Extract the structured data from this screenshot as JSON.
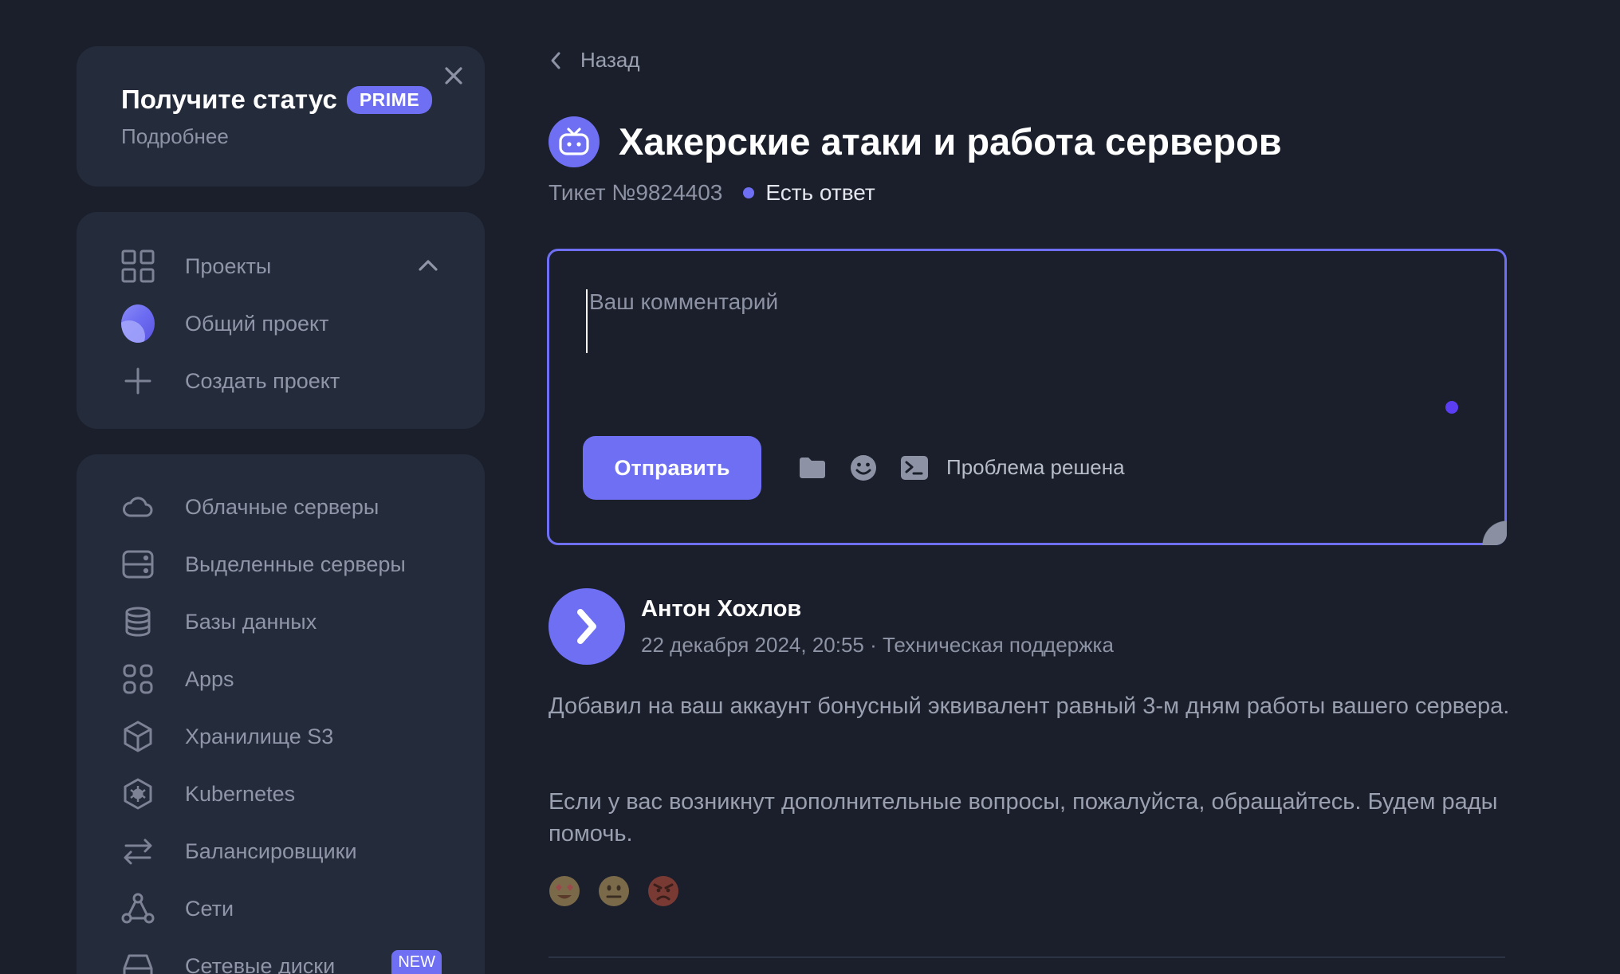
{
  "colors": {
    "background": "#1b1f2b",
    "card": "#242b3b",
    "accent": "#6e6ff2",
    "muted_text": "#8d93a4"
  },
  "promo": {
    "title": "Получите статус",
    "badge": "PRIME",
    "more": "Подробнее",
    "close_icon": "close-icon"
  },
  "projects": {
    "header": "Проекты",
    "items": [
      {
        "label": "Общий проект",
        "icon": "project-avatar-icon"
      },
      {
        "label": "Создать проект",
        "icon": "plus-icon"
      }
    ]
  },
  "menu": {
    "items": [
      {
        "label": "Облачные серверы",
        "icon": "cloud-icon"
      },
      {
        "label": "Выделенные серверы",
        "icon": "server-icon"
      },
      {
        "label": "Базы данных",
        "icon": "database-icon"
      },
      {
        "label": "Apps",
        "icon": "apps-icon"
      },
      {
        "label": "Хранилище S3",
        "icon": "storage-cube-icon"
      },
      {
        "label": "Kubernetes",
        "icon": "kubernetes-icon"
      },
      {
        "label": "Балансировщики",
        "icon": "balancer-arrows-icon"
      },
      {
        "label": "Сети",
        "icon": "network-icon"
      },
      {
        "label": "Сетевые диски",
        "icon": "disk-icon",
        "badge": "NEW"
      }
    ]
  },
  "main": {
    "back_label": "Назад",
    "title": "Хакерские атаки и работа серверов",
    "ticket_number": "Тикет №9824403",
    "status": "Есть ответ",
    "comment": {
      "placeholder": "Ваш комментарий",
      "value": "",
      "send_label": "Отправить",
      "solved_label": "Проблема решена"
    },
    "reply": {
      "author": "Антон Хохлов",
      "meta": "22 декабря 2024, 20:55 · Техническая поддержка",
      "paragraphs": [
        "Добавил на ваш аккаунт бонусный эквивалент равный 3-м дням работы вашего сервера.",
        "Если у вас возникнут дополнительные вопросы, пожалуйста, обращайтесь. Будем рады помочь."
      ],
      "reactions": [
        "😍",
        "😐",
        "😡"
      ]
    }
  }
}
